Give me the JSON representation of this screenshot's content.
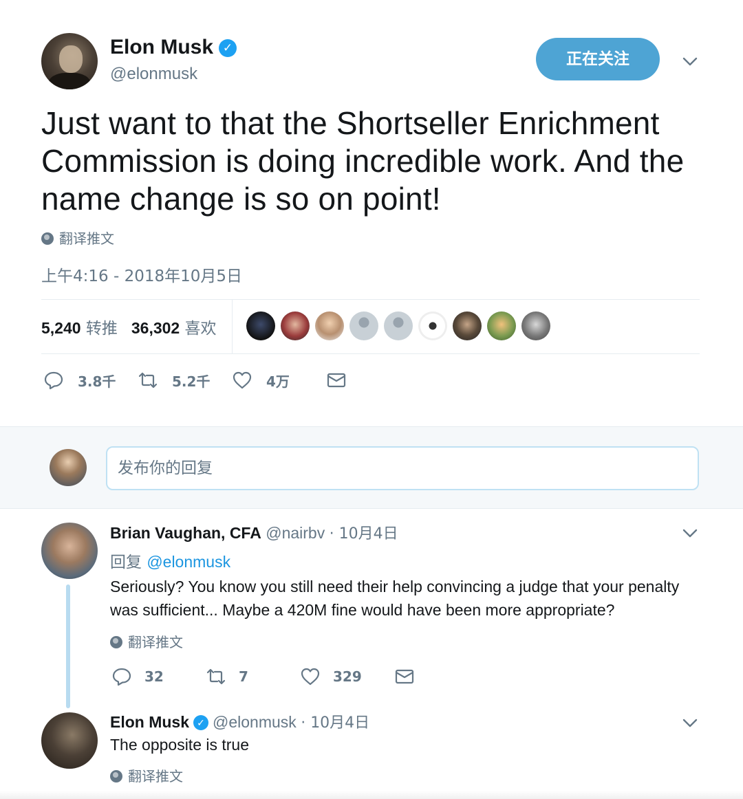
{
  "tweet": {
    "author_name": "Elon Musk",
    "author_handle": "@elonmusk",
    "follow_label": "正在关注",
    "text": "Just want to that the Shortseller Enrichment Commission is doing incredible work. And the name change is so on point!",
    "translate_label": "翻译推文",
    "timestamp": "上午4:16 - 2018年10月5日",
    "retweets_count": "5,240",
    "retweets_label": "转推",
    "likes_count": "36,302",
    "likes_label": "喜欢",
    "actions": {
      "reply_count": "3.8千",
      "retweet_count": "5.2千",
      "like_count": "4万"
    }
  },
  "composer": {
    "placeholder": "发布你的回复"
  },
  "replies": [
    {
      "author_name": "Brian Vaughan, CFA",
      "author_handle": "@nairbv",
      "date": "· 10月4日",
      "reply_to_label": "回复",
      "reply_to_handle": "@elonmusk",
      "text": "Seriously? You know you still need their help convincing a judge that your penalty was sufficient... Maybe a 420M fine would have been more appropriate?",
      "translate_label": "翻译推文",
      "reply_count": "32",
      "retweet_count": "7",
      "like_count": "329"
    },
    {
      "author_name": "Elon Musk",
      "author_handle": "@elonmusk",
      "date": "· 10月4日",
      "text": "The opposite is true",
      "translate_label": "翻译推文"
    }
  ],
  "colors": {
    "accent": "#1da1f2",
    "follow_button": "#4ea4d4",
    "muted_text": "#657786",
    "link": "#1b95e0",
    "thread_line": "#b8dbf0"
  }
}
